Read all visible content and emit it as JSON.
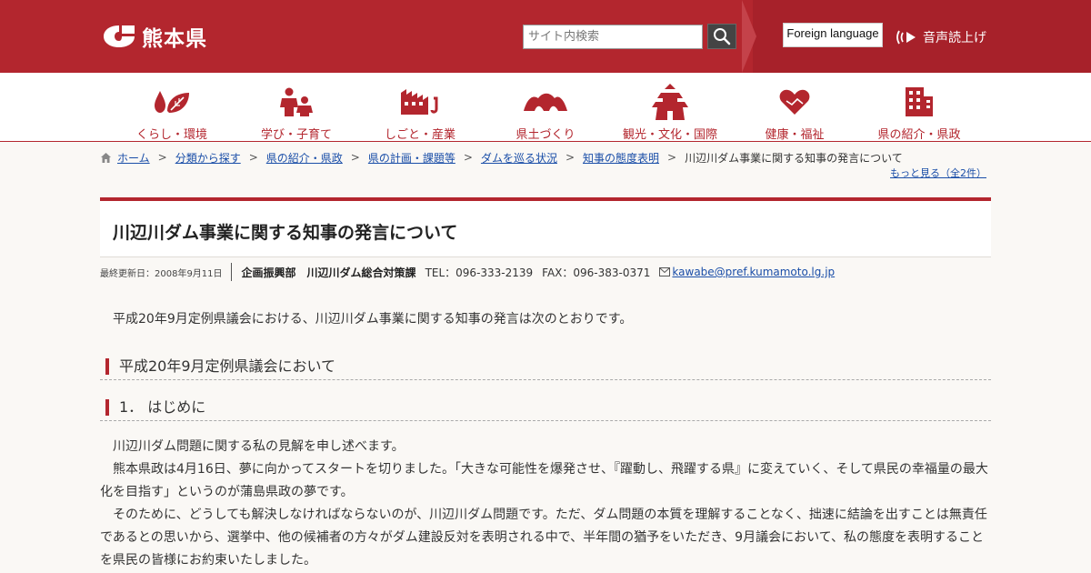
{
  "header": {
    "logo_text": "熊本県",
    "search_placeholder": "サイト内検索",
    "foreign_language": "Foreign language",
    "voice_label": "音声読上げ",
    "colors": {
      "brand": "#b3262e",
      "nav_text": "#b3262e",
      "link": "#1a4ea8"
    }
  },
  "gnav": [
    {
      "label": "くらし・環境",
      "icon": "leaf-drop-icon"
    },
    {
      "label": "学び・子育て",
      "icon": "parent-child-icon"
    },
    {
      "label": "しごと・産業",
      "icon": "factory-icon"
    },
    {
      "label": "県土づくり",
      "icon": "landscape-icon"
    },
    {
      "label": "観光・文化・国際",
      "icon": "castle-icon"
    },
    {
      "label": "健康・福祉",
      "icon": "heart-hands-icon"
    },
    {
      "label": "県の紹介・県政",
      "icon": "building-icon"
    }
  ],
  "breadcrumb": {
    "items": [
      "ホーム",
      "分類から探す",
      "県の紹介・県政",
      "県の計画・課題等",
      "ダムを巡る状況",
      "知事の態度表明"
    ],
    "separator": ">",
    "current": "川辺川ダム事業に関する知事の発言について",
    "more": "もっと見る（全2件）"
  },
  "page": {
    "title": "川辺川ダム事業に関する知事の発言について",
    "updated": "最終更新日：2008年9月11日",
    "department": "企画振興部　川辺川ダム総合対策課",
    "tel": "TEL：096-333-2139",
    "fax": "FAX：096-383-0371",
    "email": "kawabe@pref.kumamoto.lg.jp",
    "intro": "平成20年9月定例県議会における、川辺川ダム事業に関する知事の発言は次のとおりです。",
    "h2": "平成20年9月定例県議会において",
    "h3": "1．  はじめに",
    "paragraphs": [
      "川辺川ダム問題に関する私の見解を申し述べます。",
      "熊本県政は4月16日、夢に向かってスタートを切りました。「大きな可能性を爆発させ、『躍動し、飛躍する県』に変えていく、そして県民の幸福量の最大化を目指す」というのが蒲島県政の夢です。",
      "そのために、どうしても解決しなければならないのが、川辺川ダム問題です。ただ、ダム問題の本質を理解することなく、拙速に結論を出すことは無責任であるとの思いから、選挙中、他の候補者の方々がダム建設反対を表明される中で、半年間の猶予をいただき、9月議会において、私の態度を表明することを県民の皆様にお約束いたしました。"
    ]
  }
}
